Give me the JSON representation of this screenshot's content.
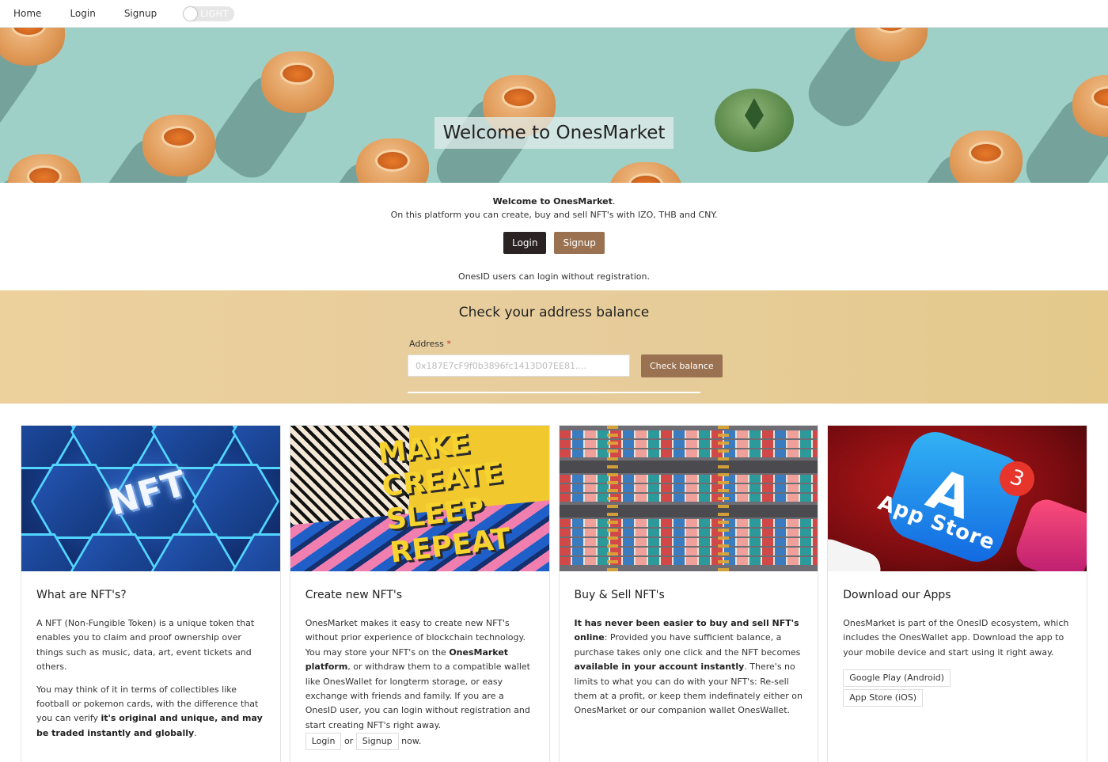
{
  "nav": {
    "home": "Home",
    "login": "Login",
    "signup": "Signup",
    "theme_toggle": "LIGHT"
  },
  "hero": {
    "title": "Welcome to OnesMarket"
  },
  "intro": {
    "welcome_bold": "Welcome to OnesMarket",
    "welcome_rest": ".",
    "description": "On this platform you can create, buy and sell NFT's with IZO, THB and CNY.",
    "login_button": "Login",
    "signup_button": "Signup",
    "onesid_note": "OnesID users can login without registration."
  },
  "balance": {
    "heading": "Check your address balance",
    "address_label": "Address",
    "required_mark": "*",
    "address_placeholder": "0x187E7cF9f0b3896fc1413D07EE81....",
    "check_button": "Check balance"
  },
  "cards": [
    {
      "title": "What are NFT's?",
      "image_text": "NFT",
      "p1": "A NFT (Non-Fungible Token) is a unique token that enables you to claim and proof ownership over things such as music, data, art, event tickets and others.",
      "p2_a": "You may think of it in terms of collectibles like football or pokemon cards, with the difference that you can verify ",
      "p2_b": "it's original and unique, and may be traded instantly and globally",
      "p2_c": "."
    },
    {
      "title": "Create new NFT's",
      "image_lines": [
        "MAKE",
        "CREATE",
        "SLEEP",
        "REPEAT"
      ],
      "p1_a": "OnesMarket makes it easy to create new NFT's without prior experience of blockchain technology. You may store your NFT's on the ",
      "p1_b": "OnesMarket platform",
      "p1_c": ", or withdraw them to a compatible wallet like OnesWallet for longterm storage, or easy exchange with friends and family. If you are a OnesID user, you can login without registration and start creating NFT's right away.",
      "login_link": "Login",
      "or_text": "or",
      "signup_link": "Signup",
      "now_text": "now."
    },
    {
      "title": "Buy & Sell NFT's",
      "p1_a": "It has never been easier to buy and sell NFT's online",
      "p1_b": ": Provided you have sufficient balance, a purchase takes only one click and the NFT becomes ",
      "p1_c": "available in your account instantly",
      "p1_d": ". There's no limits to what you can do with your NFT's: Re-sell them at a profit, or keep them indefinately either on OnesMarket or our companion wallet OnesWallet."
    },
    {
      "title": "Download our Apps",
      "image_text": "App Store",
      "badge_count": "3",
      "p1": "OnesMarket is part of the OnesID ecosystem, which includes the OnesWallet app. Download the app to your mobile device and start using it right away.",
      "google_play": "Google Play (Android)",
      "app_store": "App Store (iOS)"
    }
  ]
}
